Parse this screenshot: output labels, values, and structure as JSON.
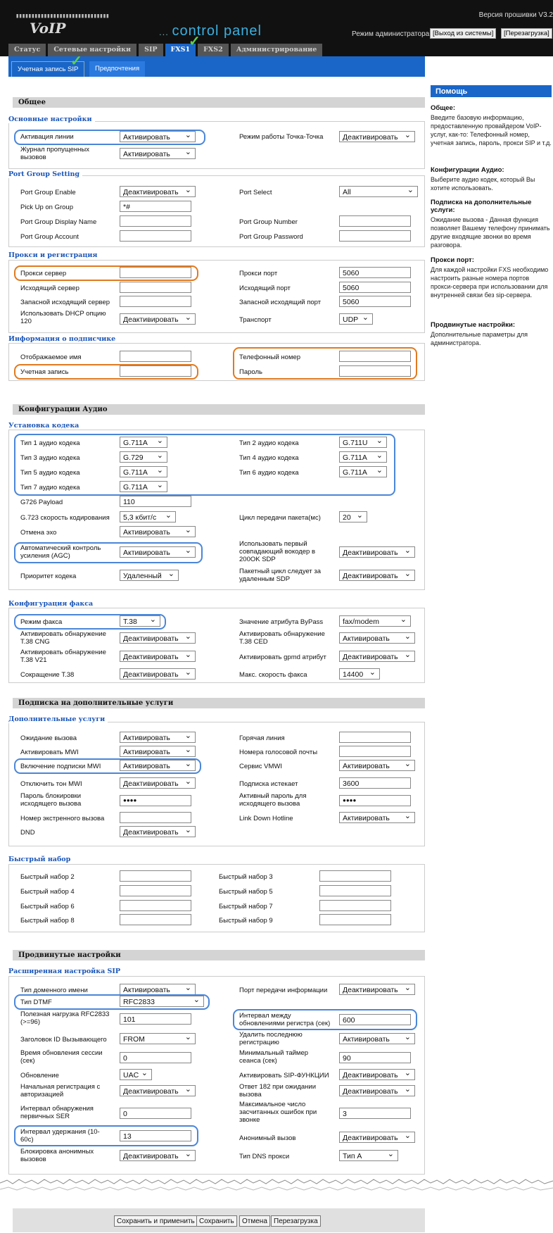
{
  "header": {
    "firmware": "Версия прошивки V3.2",
    "mode": "Режим администратора",
    "logout": "[Выход из системы]",
    "reboot": "[Перезагрузка]",
    "voip": "VoIP",
    "control_panel": "control panel",
    "stripes": "▮▮▮▮▮▮▮▮▮▮▮▮▮▮▮▮▮▮▮▮▮▮▮▮▮▮▮▮▮▮"
  },
  "tabs": [
    "Статус",
    "Сетевые настройки",
    "SIP",
    "FXS1",
    "FXS2",
    "Администрирование"
  ],
  "subtabs": [
    "Учетная запись SIP",
    "Предпочтения"
  ],
  "help": {
    "title": "Помощь",
    "items": [
      {
        "h": "Общее:",
        "p": "Введите базовую информацию, предоставленную провайдером VoIP-услуг, как-то: Телефонный номер, учетная запись, пароль, прокси SIP и т.д."
      },
      {
        "h": "Конфигурации Аудио:",
        "p": "Выберите аудио кодек, который Вы хотите использовать."
      },
      {
        "h": "Подписка на дополнительные услуги:",
        "p": "Ожидание вызова - Данная функция позволяет Вашему телефону принимать другие входящие звонки во время разговора."
      },
      {
        "h": "Прокси порт:",
        "p": "Для каждой настройки FXS необходимо настроить разные номера портов прокси-сервера при использовании для внутренней связи без sip-сервера."
      },
      {
        "h": "Продвинутые настройки:",
        "p": "Дополнительные параметры для администратора."
      }
    ]
  },
  "sections": {
    "general": "Общее",
    "audio": "Конфигурации Аудио",
    "services": "Подписка на дополнительные услуги",
    "advanced": "Продвинутые настройки"
  },
  "groups": {
    "basic": "Основные настройки",
    "port": "Port Group Setting",
    "proxy": "Прокси и регистрация",
    "sub": "Информация о подписчике",
    "codec": "Установка кодека",
    "fax": "Конфигурация факса",
    "add": "Дополнительные услуги",
    "speed": "Быстрый набор",
    "sip": "Расширенная настройка SIP"
  },
  "labels": {
    "line": "Активация линии",
    "missed": "Журнал пропущенных вызовов",
    "p2p": "Режим работы Точка-Точка",
    "pge": "Port Group Enable",
    "pickup": "Pick Up on Group",
    "pgdn": "Port Group Display Name",
    "pga": "Port Group Account",
    "ps": "Port Select",
    "pgn": "Port Group Number",
    "pgp": "Port Group Password",
    "proxy": "Прокси сервер",
    "outp": "Исходящий сервер",
    "bkout": "Запасной исходящий сервер",
    "dhcp120": "Использовать DHCP опцию 120",
    "pport": "Прокси порт",
    "outport": "Исходящий порт",
    "bkport": "Запасной исходящий порт",
    "transport": "Транспорт",
    "disp": "Отображаемое имя",
    "acct": "Учетная запись",
    "phone": "Телефонный номер",
    "pass": "Пароль",
    "c1": "Тип 1 аудио кодека",
    "c2": "Тип 2 аудио кодека",
    "c3": "Тип 3 аудио кодека",
    "c4": "Тип 4 аудио кодека",
    "c5": "Тип 5 аудио кодека",
    "c6": "Тип 6 аудио кодека",
    "c7": "Тип 7 аудио кодека",
    "g726": "G726 Payload",
    "g723": "G.723 скорость кодирования",
    "ptime": "Цикл передачи пакета(мс)",
    "echo": "Отмена эхо",
    "agc": "Автоматический контроль усиления (AGC)",
    "firstv": "Использовать первый совпадающий вокодер в 200OK SDP",
    "prio": "Приоритет кодека",
    "follow": "Пакетный цикл следует за удаленным SDP",
    "faxmode": "Режим факса",
    "bypass": "Значение атрибута ByPass",
    "cng": "Активировать обнаружение T.38 CNG",
    "ced": "Активировать обнаружение T.38 CED",
    "v21": "Активировать обнаружение T.38 V21",
    "gpmd": "Активировать gpmd атрибут",
    "t38r": "Сокращение T.38",
    "fspeed": "Макс. скорость факса",
    "cw": "Ожидание вызова",
    "hot": "Горячая линия",
    "mwi": "Активировать MWI",
    "vm": "Номера голосовой почты",
    "mwisub": "Включение подписки MWI",
    "vmwi": "Сервис VMWI",
    "mwitone": "Отключить тон MWI",
    "exp": "Подписка истекает",
    "blk": "Пароль блокировки исходящего вызова",
    "actpass": "Активный пароль для исходящего вызова",
    "emerg": "Номер экстренного вызова",
    "ldh": "Link Down Hotline",
    "dnd": "DND",
    "sd2": "Быстрый набор 2",
    "sd3": "Быстрый набор 3",
    "sd4": "Быстрый набор 4",
    "sd5": "Быстрый набор 5",
    "sd6": "Быстрый набор 6",
    "sd7": "Быстрый набор 7",
    "sd8": "Быстрый набор 8",
    "sd9": "Быстрый набор 9",
    "dom": "Тип доменного имени",
    "infoport": "Порт передачи информации",
    "dtmf": "Тип DTMF",
    "rfc": "Полезная нагрузка RFC2833 (>=96)",
    "regint": "Интервал между обновлениями регистра (сек)",
    "cid": "Заголовок ID Вызывающего",
    "dellast": "Удалить последнюю регистрацию",
    "sess": "Время обновления сессии (сек)",
    "minsess": "Минимальный таймер сеанса (сек)",
    "upd": "Обновление",
    "sipf": "Активировать SIP-ФУНКЦИИ",
    "init": "Начальная регистрация с авторизацией",
    "r182": "Ответ 182 при ожидании вызова",
    "ser": "Интервал обнаружения первичных SER",
    "maxerr": "Максимальное число засчитанных ошибок при звонке",
    "hold": "Интервал удержания (10-60с)",
    "anon": "Анонимный вызов",
    "anonblk": "Блокировка анонимных вызовов",
    "dnsp": "Тип DNS прокси"
  },
  "values": {
    "activate": "Активировать",
    "deactivate": "Деактивировать",
    "all": "All",
    "pickup": "*#",
    "port5060": "5060",
    "udp": "UDP",
    "g711a": "G.711A",
    "g711u": "G.711U",
    "g729": "G.729",
    "g726": "110",
    "g723": "5,3 кбит/с",
    "ptime": "20",
    "remote": "Удаленный",
    "t38": "T.38",
    "faxmodem": "fax/modem",
    "fspeed": "14400",
    "exp": "3600",
    "pwd": "●●●●",
    "rfc2833": "RFC2833",
    "rfc": "101",
    "regint": "600",
    "from": "FROM",
    "sess": "0",
    "minsess": "90",
    "uac": "UAC",
    "ser": "0",
    "maxerr": "3",
    "hold": "13",
    "typea": "Тип A"
  },
  "footer": [
    "Сохранить и применить",
    "Сохранить",
    "Отмена",
    "Перезагрузка"
  ]
}
